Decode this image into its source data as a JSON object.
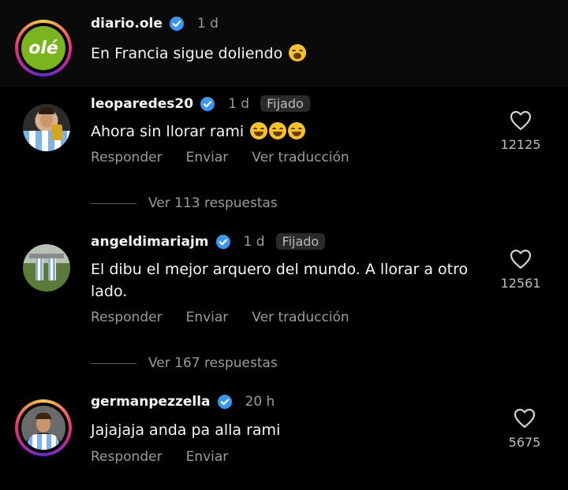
{
  "comments": [
    {
      "username": "diario.ole",
      "time": "1 d",
      "pinned": "",
      "text": "En Francia sigue doliendo",
      "avatar_text": "olé",
      "emoji": [
        "yawning-face"
      ]
    },
    {
      "username": "leoparedes20",
      "time": "1 d",
      "pinned": "Fijado",
      "text": "Ahora sin llorar rami",
      "emoji": [
        "grinning-face",
        "grinning-face",
        "grinning-face"
      ],
      "actions": [
        "Responder",
        "Enviar",
        "Ver traducción"
      ],
      "likes": "12125",
      "replies": "Ver 113 respuestas"
    },
    {
      "username": "angeldimariajm",
      "time": "1 d",
      "pinned": "Fijado",
      "text_line1": "El dibu el mejor arquero del mundo. A llorar a otro",
      "text_line2": "lado.",
      "actions": [
        "Responder",
        "Enviar",
        "Ver traducción"
      ],
      "likes": "12561",
      "replies": "Ver 167 respuestas"
    },
    {
      "username": "germanpezzella",
      "time": "20 h",
      "pinned": "",
      "text": "Jajajaja anda pa alla rami",
      "actions": [
        "Responder",
        "Enviar"
      ],
      "likes": "5675"
    }
  ],
  "colors": {
    "background": "#000000",
    "verified": "#3897f0",
    "muted": "#9a9a9a",
    "ole_green": "#7ab51d"
  },
  "icons": {
    "verified": "verified-badge-icon",
    "like": "heart-outline-icon"
  }
}
